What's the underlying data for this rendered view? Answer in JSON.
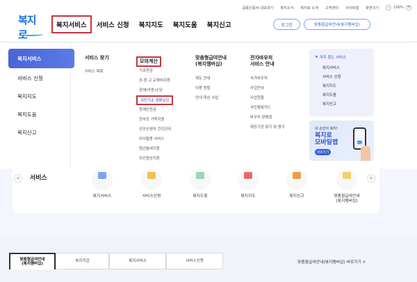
{
  "utility": {
    "links": [
      "공동인증서 내보내기",
      "복지소식",
      "복지로 소개",
      "고객센터",
      "사이트맵",
      "화면크기"
    ],
    "zoom": "100%",
    "minus": "-",
    "plus": "+"
  },
  "header": {
    "logo": "복지로",
    "login": "로그인",
    "custom_button": "맞춤형급여안내(복지멤버십)"
  },
  "gnb": [
    "복지서비스",
    "서비스 신청",
    "복지지도",
    "복지도움",
    "복지신고"
  ],
  "sidebar": {
    "active": "복지서비스",
    "items": [
      "서비스 신청",
      "복지지도",
      "복지도움",
      "복지신고"
    ]
  },
  "columns": {
    "find": {
      "title": "서비스 찾기",
      "links": [
        "서비스 목록"
      ]
    },
    "calc": {
      "title": "모의계산",
      "links": [
        "기초연금",
        "초·중·고 교육비지원",
        "장애(아동)수당",
        "국민기초 생활보장",
        "장애인연금",
        "한부모 가족지원",
        "산모신생아 건강관리",
        "아이돌봄 서비스",
        "청년월세지원",
        "자산형성지원"
      ]
    },
    "custom": {
      "title1": "맞춤형급여안내",
      "title2": "(복지멤버십)",
      "links": [
        "제도 안내",
        "이용 방법",
        "안내 대상 사업"
      ]
    },
    "voucher": {
      "title1": "전자바우처",
      "title2": "서비스 안내",
      "links": [
        "국가바우처",
        "사업안내",
        "사업현황",
        "국민행복카드",
        "바우처 판매점",
        "제공기관 찾기 및 평가"
      ]
    }
  },
  "quick": {
    "title": "자주 찾는 서비스",
    "star": "★",
    "links": [
      "복지서비스",
      "서비스 신청",
      "복지지도",
      "복지도움",
      "복지신고"
    ]
  },
  "app_banner": {
    "sub": "내 손안의 복지!",
    "title1": "복지로",
    "title2": "모바일앱",
    "button": "바로가기",
    "screen": "복지로"
  },
  "services": {
    "title": "서비스",
    "prev": "<",
    "next": ">",
    "items": [
      "복지서비스",
      "서비스신청",
      "복지도움",
      "복지지도",
      "복지신고",
      "맞춤형급여안내\n(복지멤버십)"
    ]
  },
  "bottom_tabs": {
    "tabs": [
      "맞춤형급여안내\n(복지멤버십)",
      "복지지갑",
      "복지서비스",
      "서비스신청"
    ],
    "more": "맞춤형급여안내(복지멤버십) 바로가기 >"
  }
}
